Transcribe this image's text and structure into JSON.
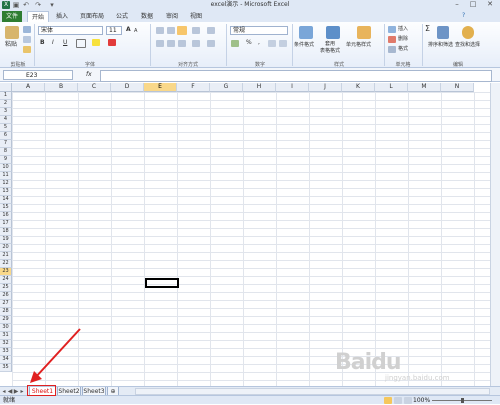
{
  "window": {
    "title": "excel演示 - Microsoft Excel",
    "controls": {
      "minimize": "–",
      "maximize": "□",
      "close": "✕"
    }
  },
  "ribbon_tabs": [
    "文件",
    "开始",
    "插入",
    "页面布局",
    "公式",
    "数据",
    "审阅",
    "视图"
  ],
  "ribbon": {
    "clipboard": {
      "paste": "粘贴",
      "group": "剪贴板"
    },
    "font": {
      "name": "宋体",
      "size": "11",
      "group": "字体",
      "bold": "B",
      "italic": "I",
      "underline": "U",
      "grow": "A",
      "shrink": "A"
    },
    "alignment": {
      "group": "对齐方式"
    },
    "number": {
      "format": "常规",
      "percent": "%",
      "comma": ",",
      "group": "数字"
    },
    "styles": {
      "conditional": "条件格式",
      "table_format": "套用\n表格格式",
      "cell_style": "单元格样式",
      "group": "样式"
    },
    "cells": {
      "insert": "插入",
      "delete": "删除",
      "format": "格式",
      "group": "单元格"
    },
    "editing": {
      "sort": "排序和筛选",
      "find": "查找和选择",
      "sum": "Σ",
      "group": "编辑"
    }
  },
  "formula_bar": {
    "cell_ref": "E23",
    "fx": "fx",
    "value": ""
  },
  "columns": [
    "A",
    "B",
    "C",
    "D",
    "E",
    "F",
    "G",
    "H",
    "I",
    "J",
    "K",
    "L",
    "M",
    "N"
  ],
  "selected_column": "E",
  "rows": [
    "1",
    "2",
    "3",
    "4",
    "5",
    "6",
    "7",
    "8",
    "9",
    "10",
    "11",
    "12",
    "13",
    "14",
    "15",
    "16",
    "17",
    "18",
    "19",
    "20",
    "21",
    "22",
    "23",
    "24",
    "25",
    "26",
    "27",
    "28",
    "29",
    "30",
    "31",
    "32",
    "33",
    "34",
    "35"
  ],
  "selected_row": "23",
  "sheets": [
    "Sheet1",
    "Sheet2",
    "Sheet3"
  ],
  "active_sheet": "Sheet1",
  "status": {
    "text": "就绪",
    "zoom": "100%"
  },
  "watermark": {
    "brand": "Baidu",
    "sub": "jingyan.baidu.com"
  }
}
